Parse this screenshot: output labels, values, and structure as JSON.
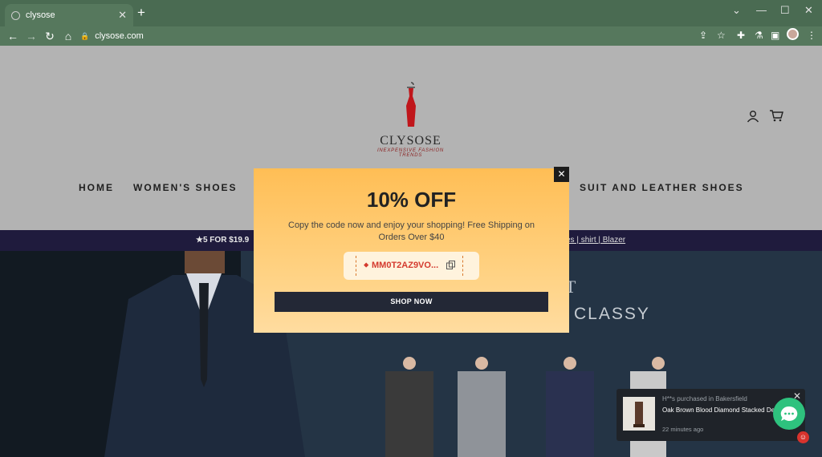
{
  "browser": {
    "tab_title": "clysose",
    "tab_close": "✕",
    "new_tab": "+",
    "url": "clysose.com",
    "controls": {
      "minimize": "—",
      "maximize": "☐",
      "close": "✕",
      "collapse": "⌄"
    }
  },
  "site": {
    "brand": "CLYSOSE",
    "tagline": "INEXPENSIVE FASHION TRENDS",
    "nav": [
      "HOME",
      "WOMEN'S SHOES",
      "SUIT AND LEATHER SHOES"
    ],
    "announcement_left": "★5 FOR $19.9",
    "announcement_right": "es | shirt | Blazer",
    "hero_text": "CLASSY",
    "hero_partial": "T"
  },
  "popup": {
    "title": "10% OFF",
    "description": "Copy the code now and enjoy your shopping! Free Shipping on Orders Over $40",
    "coupon_code": "MM0T2AZ9VO...",
    "cta": "SHOP NOW",
    "close": "✕"
  },
  "toast": {
    "who": "H**s purchased in Bakersfield",
    "product": "Oak Brown Blood Diamond Stacked Des",
    "time": "22 minutes ago",
    "close": "✕"
  },
  "colors": {
    "chrome": "#4a6b52",
    "popup": "#ffc766",
    "coupon_text": "#d43a2e",
    "cta": "#232836",
    "announce": "#1f1b3d",
    "chat": "#2ec27e"
  }
}
